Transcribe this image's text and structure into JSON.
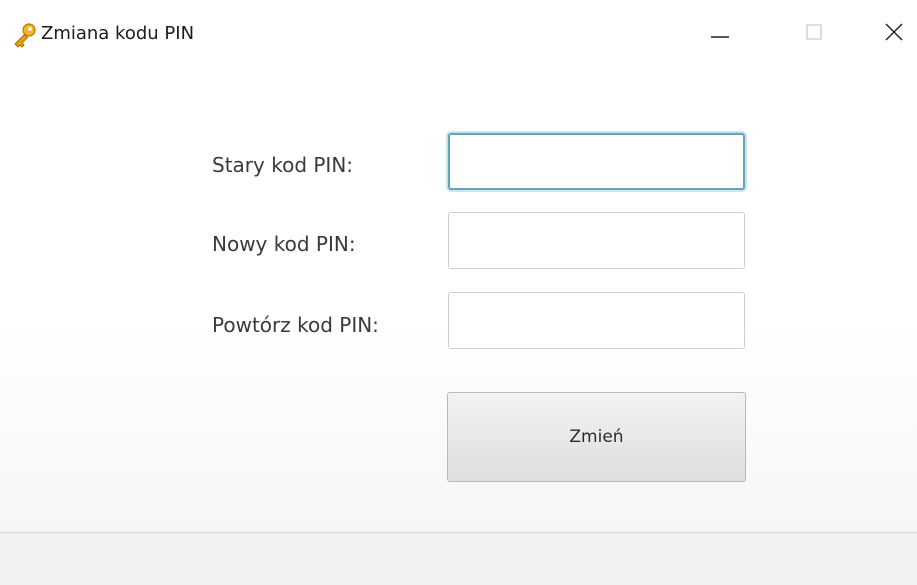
{
  "window": {
    "title": "Zmiana kodu PIN",
    "icon": "key-icon",
    "controls": [
      "minimize-icon",
      "maximize-icon",
      "close-icon"
    ]
  },
  "form": {
    "old_pin": {
      "label": "Stary kod PIN:",
      "value": "",
      "focused": true
    },
    "new_pin": {
      "label": "Nowy kod PIN:",
      "value": ""
    },
    "repeat_pin": {
      "label": "Powtórz kod PIN:",
      "value": ""
    },
    "submit_label": "Zmień"
  },
  "colors": {
    "focus_border": "#5fa7b8",
    "icon_gold": "#f0b429"
  }
}
